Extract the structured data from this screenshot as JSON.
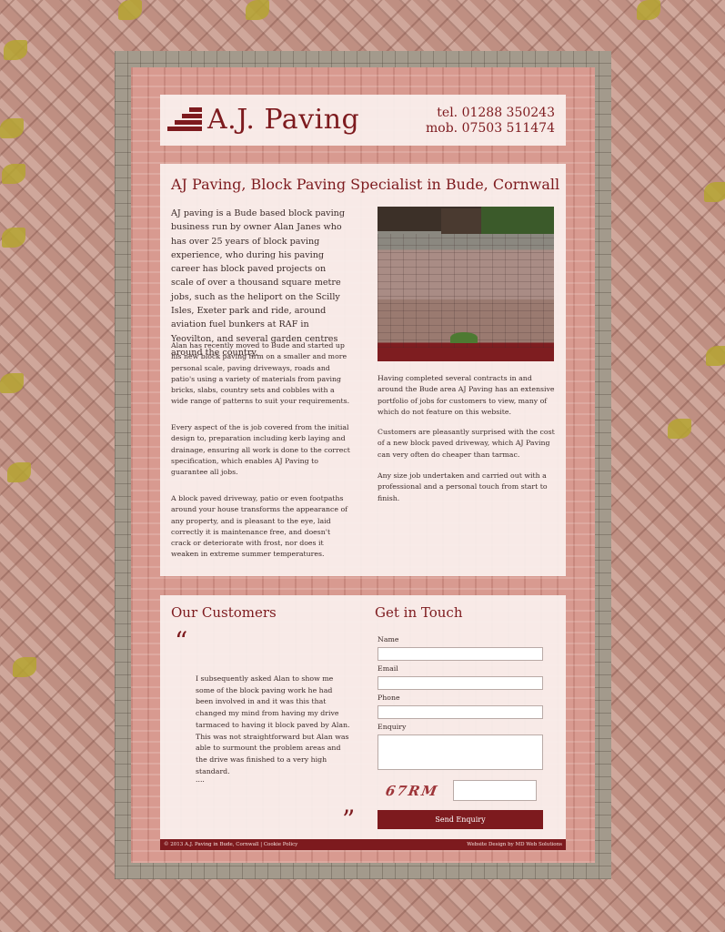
{
  "header": {
    "logo_text": "A.J. Paving",
    "phone": "tel. 01288 350243",
    "mobile": "mob. 07503 511474"
  },
  "main": {
    "title": "AJ Paving, Block Paving Specialist in Bude, Cornwall",
    "intro": "AJ paving is a Bude based block paving business run by owner Alan Janes who has over 25 years of block paving experience, who during his paving career has block paved projects on scale of over a thousand square metre jobs, such as the heliport on the Scilly Isles, Exeter park and ride, around aviation fuel bunkers at RAF in Yeovilton, and several garden centres around the country.",
    "left_paragraphs": [
      "Alan has recently moved to Bude and started up his new block paving firm on a smaller and more personal scale, paving driveways, roads and patio's using a variety of materials from paving bricks, slabs, country sets and cobbles with a wide range of patterns to suit your requirements.",
      "Every aspect of the is job covered from the initial design to, preparation including kerb laying and drainage, ensuring all work is done to the correct specification, which enables AJ Paving to guarantee all jobs.",
      "A block paved driveway, patio or even footpaths around your house transforms the appearance of any property, and is pleasant to the eye, laid correctly it is maintenance free, and doesn't crack or deteriorate with frost, nor does it weaken in extreme summer temperatures."
    ],
    "right_paragraphs": [
      "Having completed several contracts in and around the Bude area AJ Paving has an extensive portfolio of jobs for customers to view, many of which do not feature on this website.",
      "Customers are pleasantly surprised with the cost of a new block paved driveway, which AJ Paving can very often do cheaper than tarmac.",
      "Any size job undertaken and carried out with a professional and a personal touch from start to finish."
    ]
  },
  "customers": {
    "title": "Our Customers",
    "quote_open": "“",
    "quote_close": "”",
    "testimonial": "I subsequently asked Alan to show me some of the block paving work he had been involved in and it was this that changed my mind from having my drive tarmaced to having it block paved by Alan. This was not straightforward but Alan was able to surmount the problem areas and the drive was finished to a very high standard.",
    "more": "...."
  },
  "contact_form": {
    "title": "Get in Touch",
    "name_label": "Name",
    "email_label": "Email",
    "phone_label": "Phone",
    "enquiry_label": "Enquiry",
    "captcha_text": "67RM",
    "submit_label": "Send Enquiry"
  },
  "footer": {
    "left": "© 2013 A.J. Paving in Bude, Cornwall | Cookie Policy",
    "right": "Website Design by MD Web Solutions"
  },
  "colors": {
    "accent": "#7d1a1e",
    "panel": "#faf0ee"
  }
}
